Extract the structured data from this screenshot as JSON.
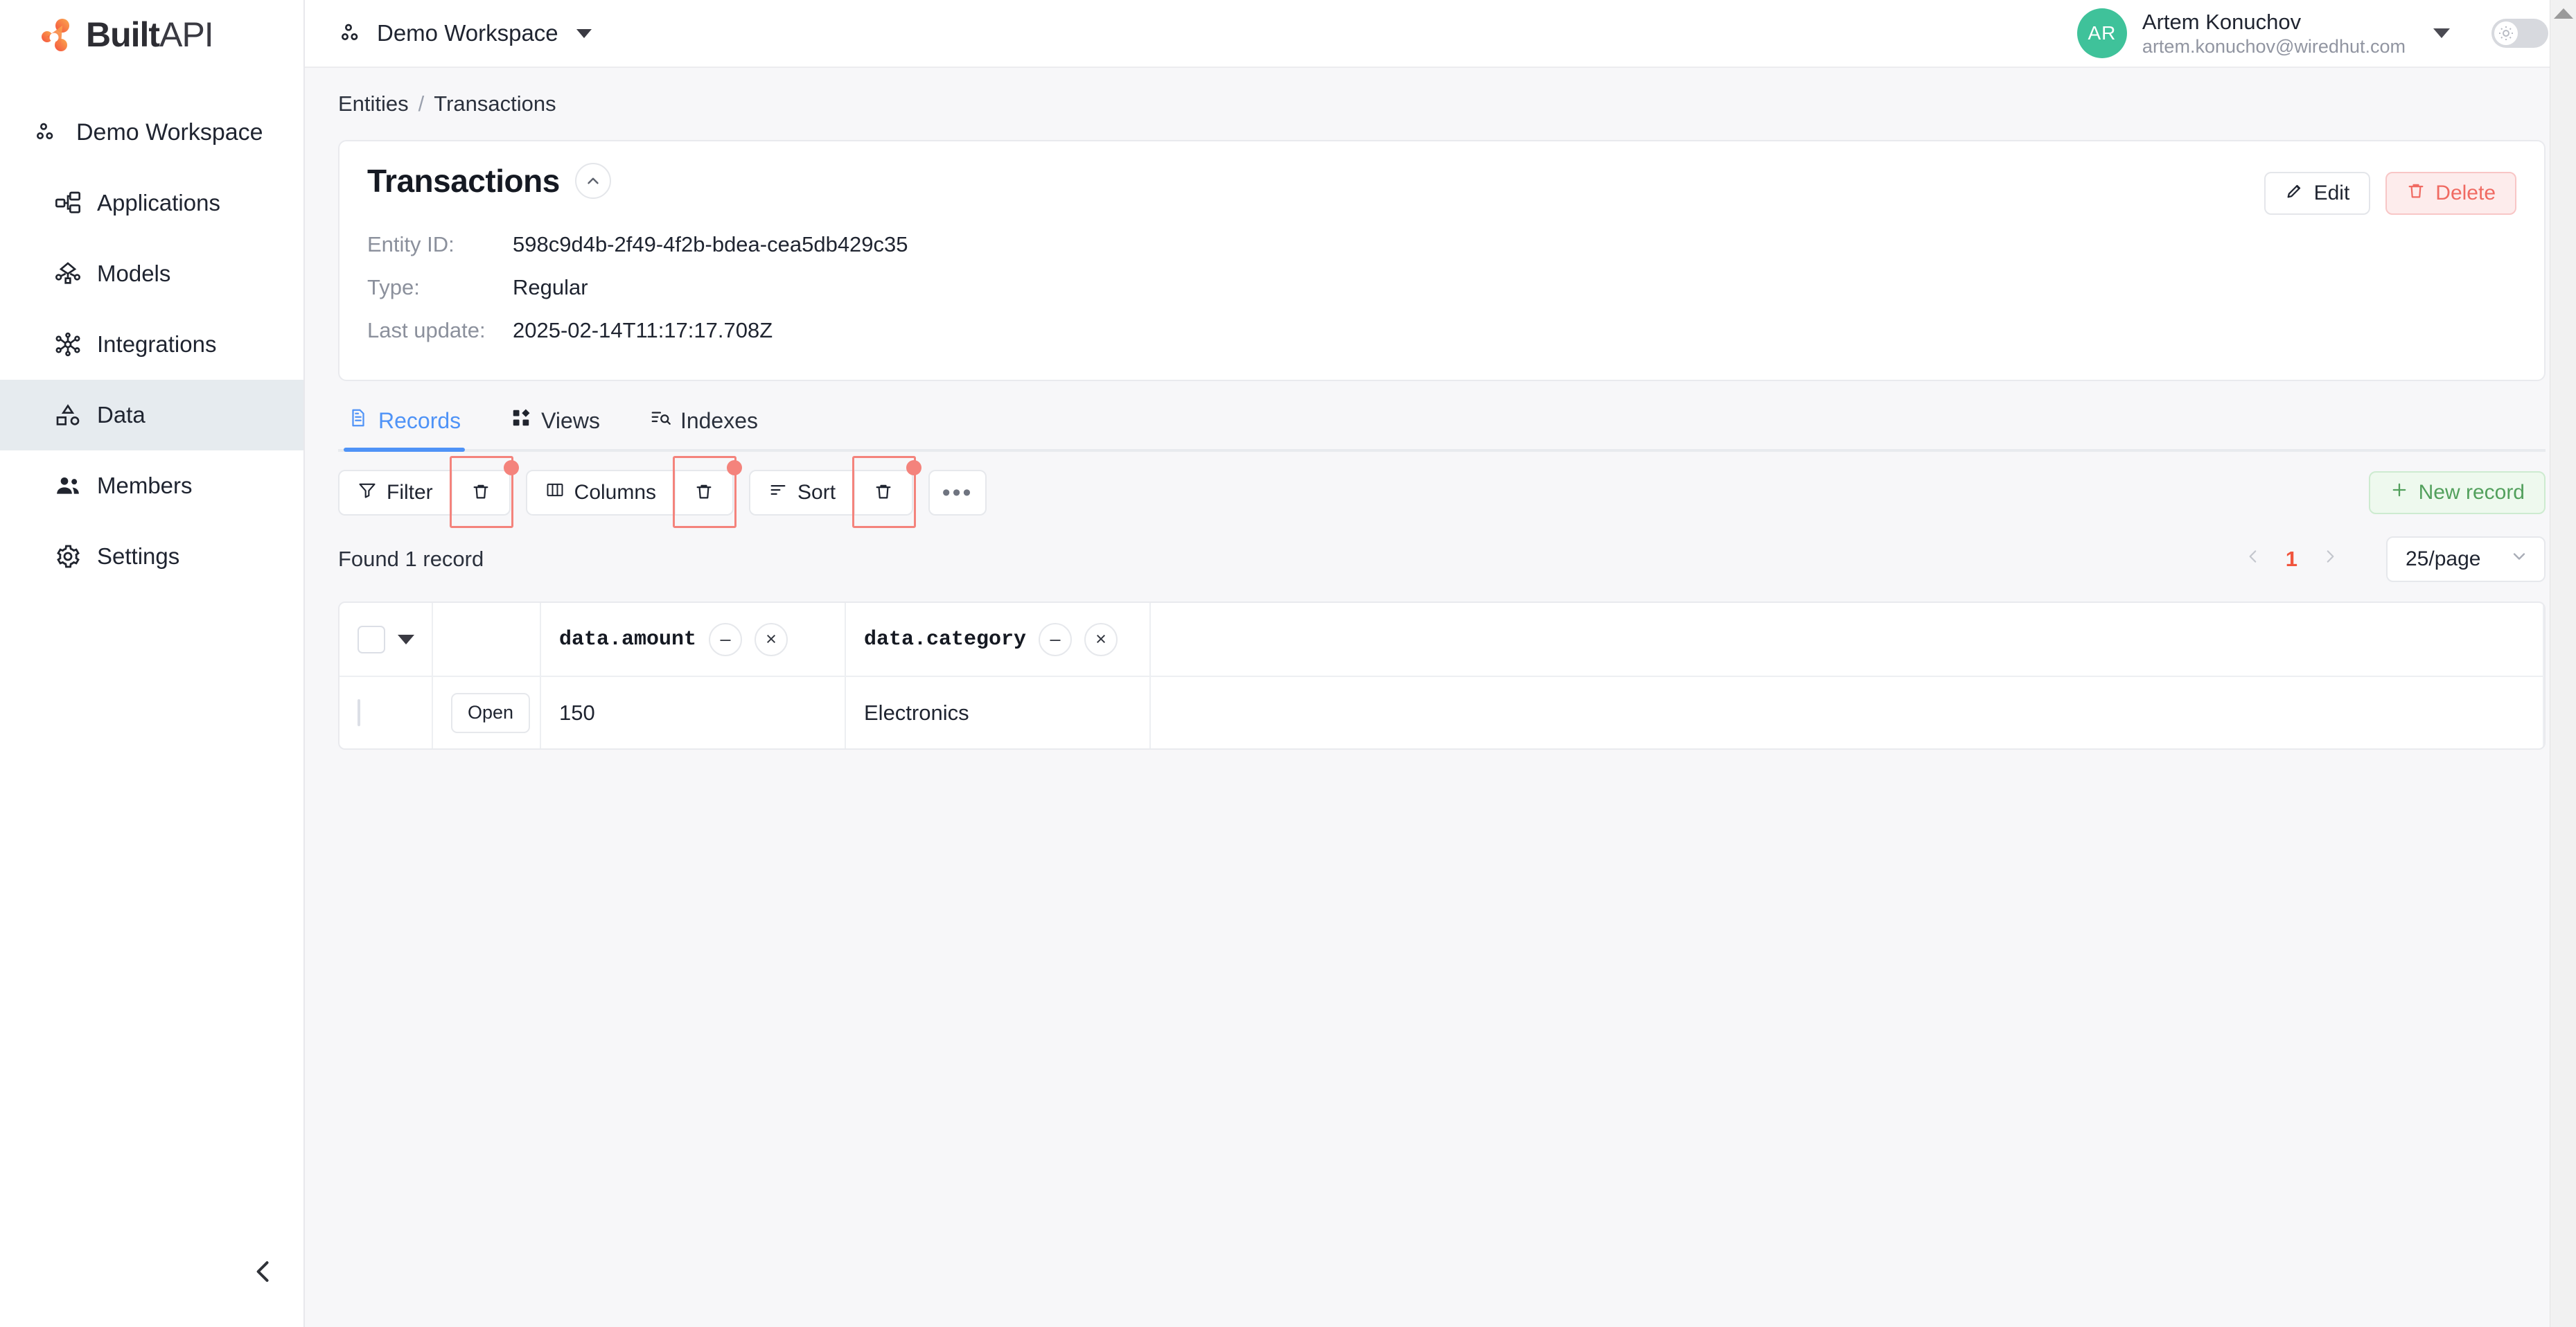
{
  "brand": {
    "name_bold": "Built",
    "name_light": "API"
  },
  "sidebar": {
    "workspace_label": "Demo Workspace",
    "items": [
      {
        "label": "Applications",
        "icon": "applications-icon"
      },
      {
        "label": "Models",
        "icon": "models-icon"
      },
      {
        "label": "Integrations",
        "icon": "integrations-icon"
      },
      {
        "label": "Data",
        "icon": "data-icon"
      },
      {
        "label": "Members",
        "icon": "members-icon"
      },
      {
        "label": "Settings",
        "icon": "settings-icon"
      }
    ],
    "active_item": "Data",
    "collapse_icon": "chevron-left-icon"
  },
  "topbar": {
    "workspace_switcher": "Demo Workspace",
    "user": {
      "initials": "AR",
      "name": "Artem Konuchov",
      "email": "artem.konuchov@wiredhut.com",
      "avatar_color": "#3fc29a"
    },
    "theme_toggle_icon": "sun-icon"
  },
  "breadcrumb": {
    "parent": "Entities",
    "separator": "/",
    "current": "Transactions"
  },
  "entity_card": {
    "title": "Transactions",
    "collapse_icon": "chevron-up-icon",
    "edit_label": "Edit",
    "edit_icon": "pencil-icon",
    "delete_label": "Delete",
    "delete_icon": "trash-icon",
    "delete_color": "#f06a62",
    "fields": [
      {
        "label": "Entity ID:",
        "value": "598c9d4b-2f49-4f2b-bdea-cea5db429c35"
      },
      {
        "label": "Type:",
        "value": "Regular"
      },
      {
        "label": "Last update:",
        "value": "2025-02-14T11:17:17.708Z"
      }
    ]
  },
  "tabs": [
    {
      "label": "Records",
      "icon": "document-icon",
      "active": true
    },
    {
      "label": "Views",
      "icon": "grid-icon",
      "active": false
    },
    {
      "label": "Indexes",
      "icon": "list-search-icon",
      "active": false
    }
  ],
  "tab_accent": "#4f93f7",
  "toolbar": {
    "filter_label": "Filter",
    "filter_icon": "funnel-icon",
    "columns_label": "Columns",
    "columns_icon": "columns-icon",
    "sort_label": "Sort",
    "sort_icon": "sort-icon",
    "trash_icon": "trash-icon",
    "more_label": "•••",
    "new_record_label": "New record",
    "new_record_icon": "plus-icon",
    "highlight_color": "#f4837c"
  },
  "results": {
    "found_text": "Found 1 record",
    "prev_icon": "chevron-left-icon",
    "next_icon": "chevron-right-icon",
    "current_page": "1",
    "page_color": "#f0553e",
    "page_size": "25/page",
    "page_size_icon": "chevron-down-icon"
  },
  "table": {
    "select_all_caret": "caret-down-icon",
    "columns": [
      {
        "name": "data.amount",
        "collapse_label": "–",
        "remove_label": "×"
      },
      {
        "name": "data.category",
        "collapse_label": "–",
        "remove_label": "×"
      }
    ],
    "rows": [
      {
        "open_label": "Open",
        "amount": "150",
        "category": "Electronics"
      }
    ]
  }
}
